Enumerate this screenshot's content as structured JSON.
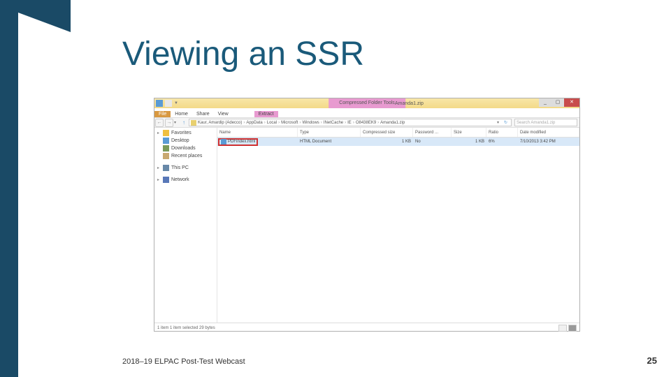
{
  "slide": {
    "title": "Viewing an SSR",
    "footer": "2018–19 ELPAC Post-Test Webcast",
    "page_number": "25"
  },
  "explorer": {
    "titlebar": {
      "tool_tab": "Compressed Folder Tools",
      "window_title": "Amanda1.zip",
      "min": "_",
      "max": "▢",
      "close": "✕"
    },
    "ribbon": {
      "file": "File",
      "home": "Home",
      "share": "Share",
      "view": "View",
      "extract": "Extract"
    },
    "breadcrumb": {
      "p1": "Kaur, Amardip (Adecco)",
      "p2": "AppData",
      "p3": "Local",
      "p4": "Microsoft",
      "p5": "Windows",
      "p6": "INetCache",
      "p7": "IE",
      "p8": "O8438EK9",
      "p9": "Amanda1.zip"
    },
    "search_placeholder": "Search Amanda1.zip",
    "sidebar": {
      "favorites": "Favorites",
      "desktop": "Desktop",
      "downloads": "Downloads",
      "recent": "Recent places",
      "thispc": "This PC",
      "network": "Network"
    },
    "columns": {
      "name": "Name",
      "type": "Type",
      "csize": "Compressed size",
      "password": "Password ...",
      "size": "Size",
      "ratio": "Ratio",
      "date": "Date modified"
    },
    "file": {
      "name": "PDFindex.html",
      "type": "HTML Document",
      "csize": "1 KB",
      "password": "No",
      "size": "1 KB",
      "ratio": "6%",
      "date": "7/10/2013 3:42 PM"
    },
    "status": {
      "text": "1 item    1 item selected  29 bytes"
    }
  }
}
